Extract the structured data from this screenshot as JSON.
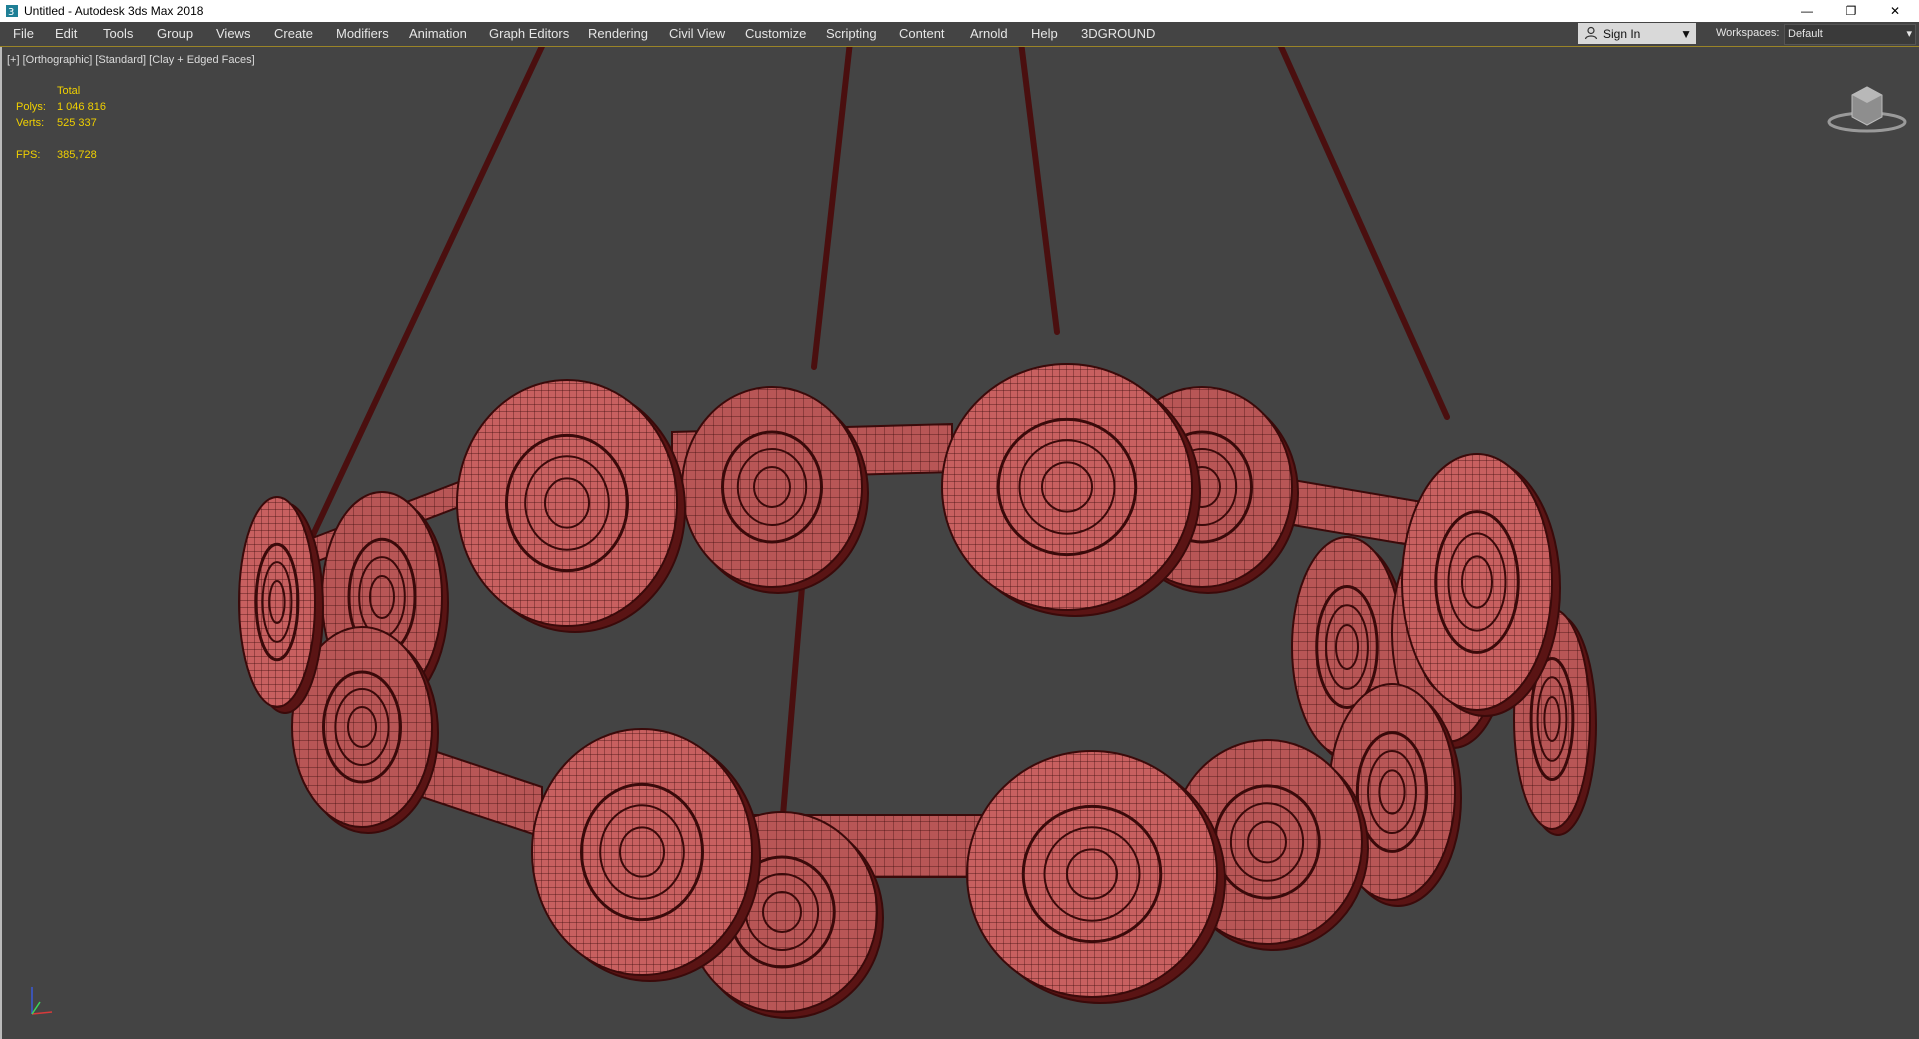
{
  "window": {
    "title": "Untitled - Autodesk 3ds Max 2018",
    "controls": {
      "minimize": "—",
      "restore": "❐",
      "close": "✕"
    }
  },
  "menu": {
    "items": [
      "File",
      "Edit",
      "Tools",
      "Group",
      "Views",
      "Create",
      "Modifiers",
      "Animation",
      "Graph Editors",
      "Rendering",
      "Civil View",
      "Customize",
      "Scripting",
      "Content",
      "Arnold",
      "Help",
      "3DGROUND"
    ]
  },
  "signin": {
    "label": "Sign In",
    "icon": "user-icon"
  },
  "workspaces": {
    "label": "Workspaces:",
    "value": "Default"
  },
  "viewport": {
    "label": "[+] [Orthographic] [Standard] [Clay + Edged Faces]",
    "stats": {
      "total_label": "Total",
      "polys_label": "Polys:",
      "polys_value": "1 046 816",
      "verts_label": "Verts:",
      "verts_value": "525 337",
      "fps_label": "FPS:",
      "fps_value": "385,728"
    }
  },
  "colors": {
    "viewport_bg": "#444444",
    "stats_text": "#f0d000",
    "mesh_fill": "#c86060",
    "mesh_wire": "#3a0a0a",
    "menu_accent": "#9a8428"
  },
  "icons": [
    "app-icon",
    "viewcube-icon",
    "axis-tripod-icon",
    "user-icon",
    "chevron-down-icon"
  ]
}
